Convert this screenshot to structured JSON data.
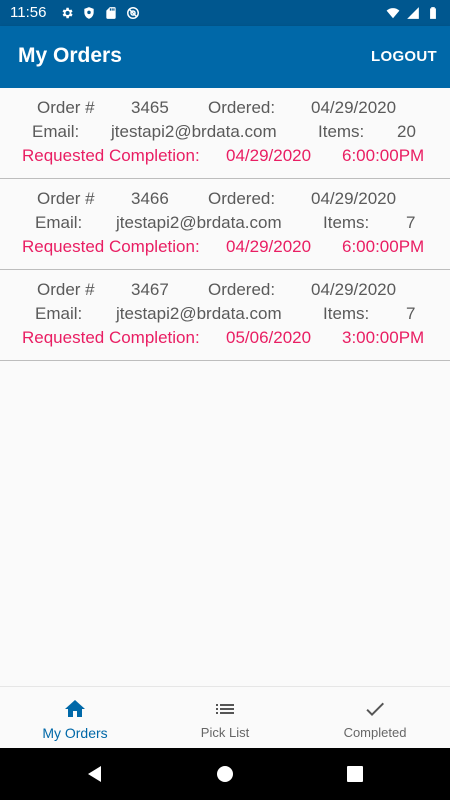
{
  "status_bar": {
    "time": "11:56",
    "left_icons": [
      "gear-icon",
      "shield-icon",
      "sd-card-icon",
      "at-sign-icon"
    ],
    "right_icons": [
      "wifi-icon",
      "signal-icon",
      "battery-icon"
    ]
  },
  "app_bar": {
    "title": "My Orders",
    "logout_label": "LOGOUT",
    "color": "#0068a8"
  },
  "labels": {
    "order": "Order #",
    "ordered": "Ordered:",
    "email": "Email:",
    "items": "Items:",
    "requested": "Requested Completion:"
  },
  "orders": [
    {
      "number": "3465",
      "ordered": "04/29/2020",
      "email": "jtestapi2@brdata.com",
      "items": "20",
      "req_date": "04/29/2020",
      "req_time": "6:00:00PM"
    },
    {
      "number": "3466",
      "ordered": "04/29/2020",
      "email": "jtestapi2@brdata.com",
      "items": "7",
      "req_date": "04/29/2020",
      "req_time": "6:00:00PM"
    },
    {
      "number": "3467",
      "ordered": "04/29/2020",
      "email": "jtestapi2@brdata.com",
      "items": "7",
      "req_date": "05/06/2020",
      "req_time": "3:00:00PM"
    }
  ],
  "bottom_nav": [
    {
      "label": "My Orders",
      "icon": "home-icon",
      "active": true
    },
    {
      "label": "Pick List",
      "icon": "list-icon",
      "active": false
    },
    {
      "label": "Completed",
      "icon": "check-icon",
      "active": false
    }
  ],
  "colors": {
    "accent": "#e91e63",
    "status_bar": "#00578f"
  }
}
